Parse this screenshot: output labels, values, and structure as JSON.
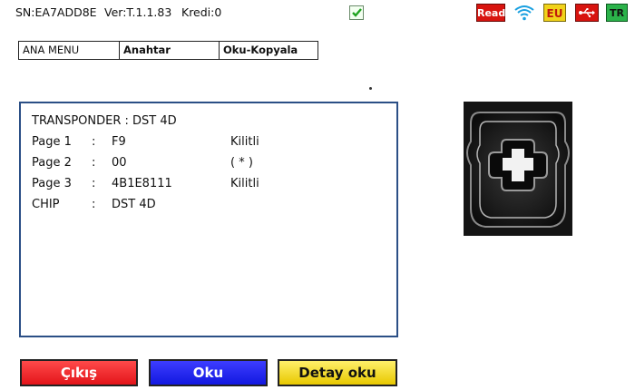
{
  "status_bar": {
    "serial": "SN:EA7ADD8E",
    "version": "Ver:T.1.1.83",
    "credit": "Kredi:0",
    "icons": [
      "checkbox-checked-icon",
      "read-icon",
      "wifi-icon",
      "eu-region-icon",
      "usb-icon",
      "tr-language-icon"
    ],
    "read_label": "Read",
    "eu_label": "EU",
    "tr_label": "TR"
  },
  "breadcrumb": [
    "ANA MENU",
    "Anahtar",
    "Oku-Kopyala"
  ],
  "info": {
    "transponder": "TRANSPONDER : DST 4D",
    "rows": [
      {
        "label": "Page 1",
        "sep": ":",
        "value": "F9",
        "status": "Kilitli"
      },
      {
        "label": "Page 2",
        "sep": ":",
        "value": "00",
        "status": "( * )"
      },
      {
        "label": "Page 3",
        "sep": ":",
        "value": "4B1E8111",
        "status": "Kilitli"
      },
      {
        "label": "CHIP",
        "sep": ":",
        "value": "DST 4D",
        "status": ""
      }
    ]
  },
  "buttons": {
    "exit": "Çıkış",
    "read": "Oku",
    "detail_read": "Detay oku"
  },
  "colors": {
    "panel_border": "#2b4f86",
    "exit_button": "#e3141a",
    "read_button": "#1218e0",
    "detail_button": "#e8c800"
  }
}
